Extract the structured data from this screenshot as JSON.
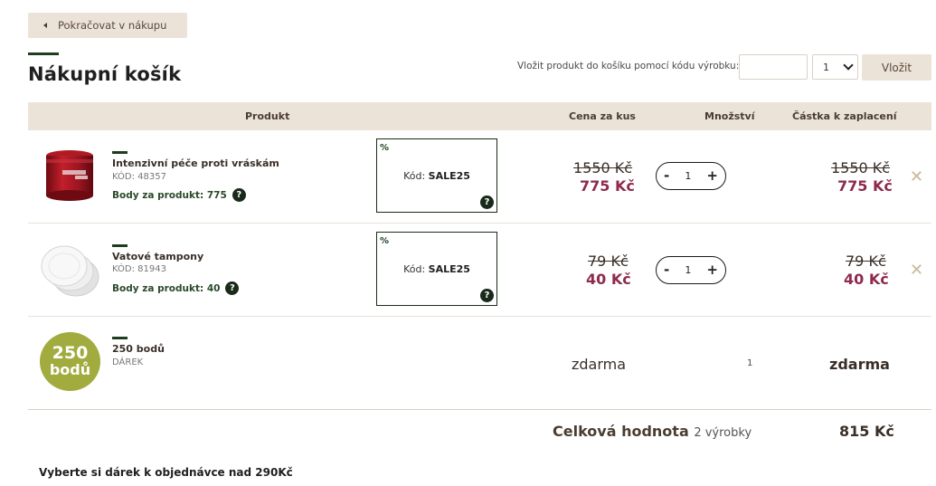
{
  "nav": {
    "back_label": "Pokračovat v nákupu"
  },
  "page_title": "Nákupní košík",
  "code_form": {
    "label": "Vložit produkt do košíku pomocí kódu výrobku:",
    "code_value": "",
    "qty_selected": "1",
    "submit_label": "Vložit"
  },
  "table": {
    "headers": {
      "product": "Produkt",
      "unit_price": "Cena za kus",
      "quantity": "Množství",
      "amount": "Částka k zaplacení"
    },
    "items": [
      {
        "name": "Intenzivní péče proti vráskám",
        "code": "KÓD: 48357",
        "points": "Body za produkt: 775",
        "promo_pct": "%",
        "promo_code_label": "Kód:",
        "promo_code": "SALE25",
        "price_old": "1550 Kč",
        "price_new": "775 Kč",
        "qty_minus": "-",
        "qty": "1",
        "qty_plus": "+",
        "total_old": "1550 Kč",
        "total_new": "775 Kč",
        "remove": "✕"
      },
      {
        "name": "Vatové tampony",
        "code": "KÓD: 81943",
        "points": "Body za produkt: 40",
        "promo_pct": "%",
        "promo_code_label": "Kód:",
        "promo_code": "SALE25",
        "price_old": "79 Kč",
        "price_new": "40 Kč",
        "qty_minus": "-",
        "qty": "1",
        "qty_plus": "+",
        "total_old": "79 Kč",
        "total_new": "40 Kč",
        "remove": "✕"
      }
    ],
    "gift": {
      "badge_number": "250",
      "badge_unit": "bodů",
      "name": "250 bodů",
      "type": "DÁREK",
      "price": "zdarma",
      "qty": "1",
      "total": "zdarma"
    }
  },
  "summary": {
    "label": "Celková hodnota",
    "count": "2 výrobky",
    "total": "815 Kč"
  },
  "gift_prompt": "Vyberte si dárek k objednávce nad 290Kč",
  "icons": {
    "back": "triangle-left-icon",
    "help": "question-icon",
    "remove": "close-icon",
    "select": "chevron-down-icon"
  },
  "colors": {
    "accent_beige": "#ece3d8",
    "sale_price": "#8e2a4e",
    "dark_green": "#1e3c1e",
    "gift_badge": "#a1ab3e"
  }
}
